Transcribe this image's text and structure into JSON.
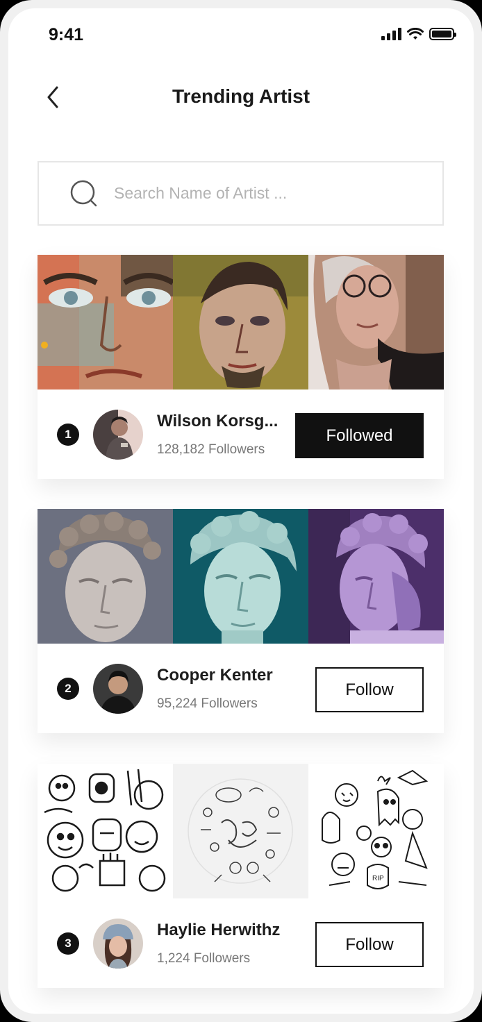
{
  "status_bar": {
    "time": "9:41"
  },
  "header": {
    "title": "Trending Artist"
  },
  "search": {
    "placeholder": "Search Name of Artist ..."
  },
  "artists": [
    {
      "rank": "1",
      "name": "Wilson Korsg...",
      "followers": "128,182 Followers",
      "button_label": "Followed",
      "followed": true,
      "artworks": [
        "painted-face-closeup",
        "painted-man-portrait",
        "painted-woman-with-glasses"
      ]
    },
    {
      "rank": "2",
      "name": "Cooper Kenter",
      "followers": "95,224 Followers",
      "button_label": "Follow",
      "followed": false,
      "artworks": [
        "marble-head-grey",
        "marble-head-teal",
        "marble-head-purple"
      ]
    },
    {
      "rank": "3",
      "name": "Haylie Herwithz",
      "followers": "1,224 Followers",
      "button_label": "Follow",
      "followed": false,
      "artworks": [
        "doodle-characters",
        "doodle-ultimate-guide",
        "doodle-halloween"
      ]
    }
  ],
  "colors": {
    "accent": "#111111",
    "card_bg": "#ffffff",
    "page_bg": "#f0f0f0"
  }
}
